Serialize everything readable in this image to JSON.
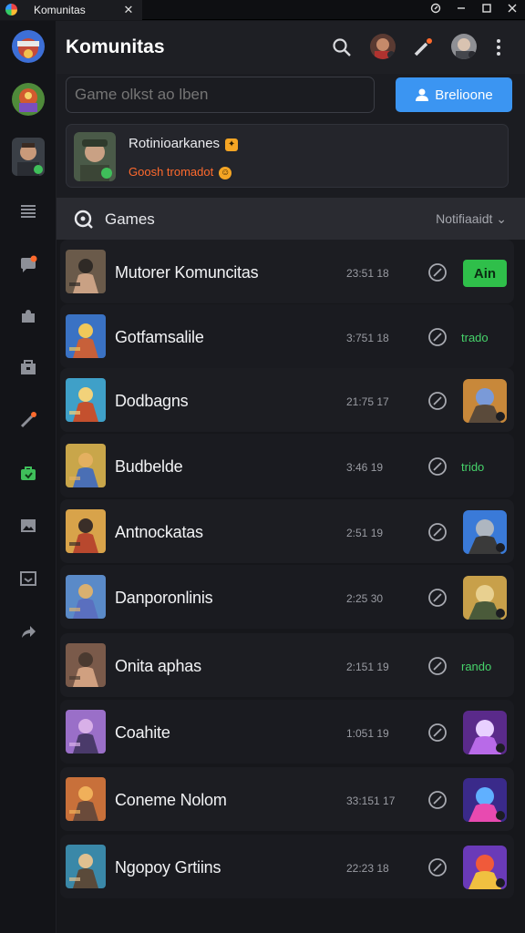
{
  "window": {
    "tab_title": "Komunitas",
    "close_glyph": "✕"
  },
  "header": {
    "title": "Komunitas"
  },
  "search": {
    "placeholder": "Game olkst ao lben",
    "button_label": "Brelioone"
  },
  "profile": {
    "name": "Rotinioarkanes",
    "status": "Goosh tromadot"
  },
  "section": {
    "title": "Games",
    "filter": "Notifiaaidt"
  },
  "games": [
    {
      "name": "Mutorer Komuncitas",
      "time": "23:51 18",
      "action": "join",
      "action_label": "Ain"
    },
    {
      "name": "Gotfamsalile",
      "time": "3:751 18",
      "action": "tag",
      "action_label": "trado"
    },
    {
      "name": "Dodbagns",
      "time": "21:75 17",
      "action": "art"
    },
    {
      "name": "Budbelde",
      "time": "3:46 19",
      "action": "tag",
      "action_label": "trido"
    },
    {
      "name": "Antnockatas",
      "time": "2:51 19",
      "action": "art"
    },
    {
      "name": "Danporonlinis",
      "time": "2:25 30",
      "action": "art"
    },
    {
      "name": "Onita aphas",
      "time": "2:151 19",
      "action": "tag",
      "action_label": "rando"
    },
    {
      "name": "Coahite",
      "time": "1:051 19",
      "action": "art"
    },
    {
      "name": "Coneme Nolom",
      "time": "33:151 17",
      "action": "art"
    },
    {
      "name": "Ngopoy Grtiins",
      "time": "22:23 18",
      "action": "art"
    }
  ],
  "colors": {
    "accent": "#3b95f2",
    "green": "#2fbf4a",
    "orange": "#ff6a2d",
    "bg": "#16171b"
  },
  "icons": [
    "search-icon",
    "pen-icon",
    "more-icon",
    "menu-icon",
    "chat-icon",
    "puzzle-icon",
    "store-icon",
    "edit-icon",
    "bag-icon",
    "image-icon",
    "inbox-icon",
    "share-icon",
    "check-circle-icon",
    "user-icon"
  ]
}
